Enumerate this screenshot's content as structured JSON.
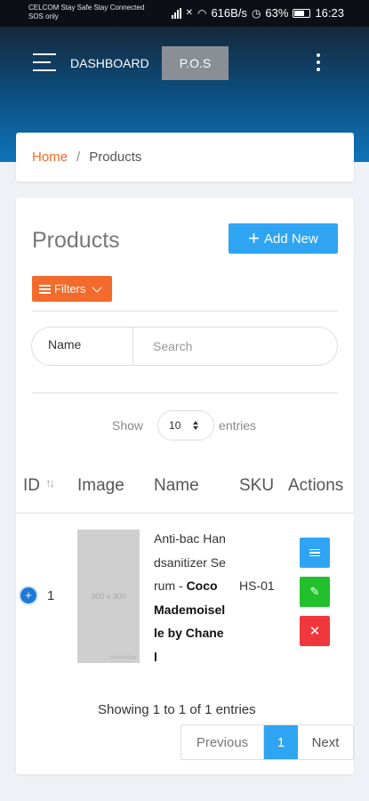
{
  "status_bar": {
    "carrier_line1": "CELCOM Stay Safe Stay Connected",
    "carrier_line2": "SOS only",
    "network_speed": "616B/s",
    "battery": "63%",
    "time": "16:23"
  },
  "header": {
    "dashboard_label": "DASHBOARD",
    "pos_label": "P.O.S"
  },
  "breadcrumb": {
    "home": "Home",
    "separator": "/",
    "current": "Products"
  },
  "products": {
    "title": "Products",
    "add_new_label": "Add New",
    "filters_label": "Filters",
    "search": {
      "field_label": "Name",
      "placeholder": "Search"
    },
    "length_control": {
      "show_label": "Show",
      "value": "10",
      "entries_label": "entries"
    },
    "table": {
      "columns": [
        "ID",
        "Image",
        "Name",
        "SKU",
        "Actions"
      ],
      "rows": [
        {
          "id": "1",
          "image_placeholder": "300 x 300",
          "image_watermark": "thumbnail.jpg",
          "name_plain": "Anti-bac Handsanitizer Serum - ",
          "name_bold": "Coco Mademoiselle by Chanel",
          "sku": "HS-01"
        }
      ]
    },
    "info": "Showing 1 to 1 of 1 entries",
    "pagination": {
      "previous": "Previous",
      "current_page": "1",
      "next": "Next"
    }
  },
  "colors": {
    "accent_orange": "#f26b2c",
    "accent_blue": "#2fa4f3",
    "success_green": "#22c02c",
    "danger_red": "#f0373c",
    "header_top": "#15283a",
    "header_bottom": "#0f74bb"
  },
  "icons": {
    "menu": "hamburger-icon",
    "more": "kebab-icon",
    "add": "plus-icon",
    "filter": "lines-icon",
    "sort": "sort-icon",
    "view": "list-icon",
    "edit": "edit-icon",
    "delete": "close-icon",
    "expand": "plus-circle-icon"
  }
}
